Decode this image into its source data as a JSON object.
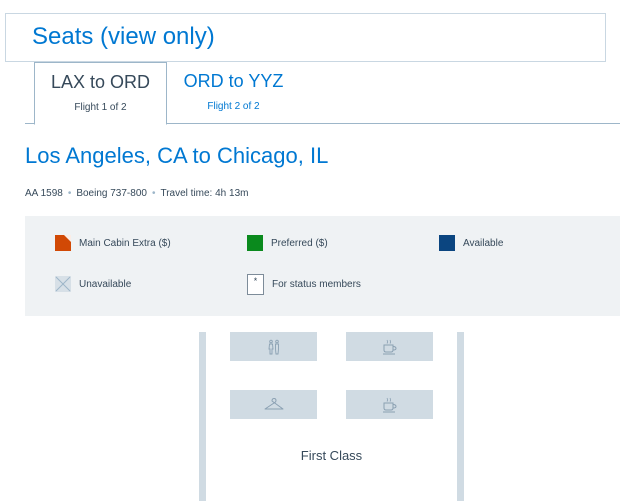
{
  "header": {
    "title": "Seats (view only)"
  },
  "tabs": [
    {
      "label": "LAX to ORD",
      "sub": "Flight 1 of 2",
      "active": true
    },
    {
      "label": "ORD to YYZ",
      "sub": "Flight 2 of 2",
      "active": false
    }
  ],
  "flight": {
    "route_title": "Los Angeles, CA to Chicago, IL",
    "number": "AA 1598",
    "aircraft": "Boeing 737-800",
    "travel_time": "Travel time: 4h 13m",
    "separator": "•"
  },
  "legend": {
    "main_cabin_extra": "Main Cabin Extra ($)",
    "preferred": "Preferred ($)",
    "available": "Available",
    "unavailable": "Unavailable",
    "status_members": "For status members",
    "status_marker": "*"
  },
  "colors": {
    "accent": "#0078d2",
    "main_cabin_extra": "#d14905",
    "preferred": "#0a8a1d",
    "available": "#0b4580",
    "unavailable": "#d7e0e7"
  },
  "cabin": {
    "label": "First Class",
    "facilities": [
      "lavatory-icon",
      "coffee-icon",
      "coat-hanger-icon",
      "coffee-icon"
    ]
  }
}
